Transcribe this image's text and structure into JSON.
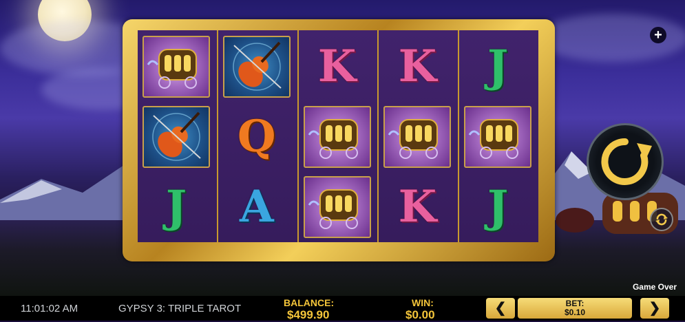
{
  "game": {
    "status_text": "Game Over"
  },
  "reels": [
    [
      "carriage",
      "violin",
      "J"
    ],
    [
      "violin",
      "Q",
      "A"
    ],
    [
      "K",
      "carriage",
      "carriage"
    ],
    [
      "K",
      "carriage",
      "K"
    ],
    [
      "J",
      "carriage",
      "J"
    ]
  ],
  "icons": {
    "plus": "plus-icon",
    "spin": "spin-arrow-icon",
    "autoplay": "autoplay-icon",
    "bet_down": "chevron-left-icon",
    "bet_up": "chevron-right-icon"
  },
  "glyphs": {
    "plus": "+",
    "left": "❮",
    "right": "❯"
  },
  "bottom_bar": {
    "time": "11:01:02 AM",
    "title": "GYPSY 3: TRIPLE TAROT",
    "balance_label": "BALANCE:",
    "balance_value": "$499.90",
    "win_label": "WIN:",
    "win_value": "$0.00",
    "bet_label": "BET:",
    "bet_value": "$0.10"
  },
  "colors": {
    "accent_gold": "#f4c53a",
    "frame_gold": "#c99a2e",
    "reel_bg": "#3a1f63"
  }
}
